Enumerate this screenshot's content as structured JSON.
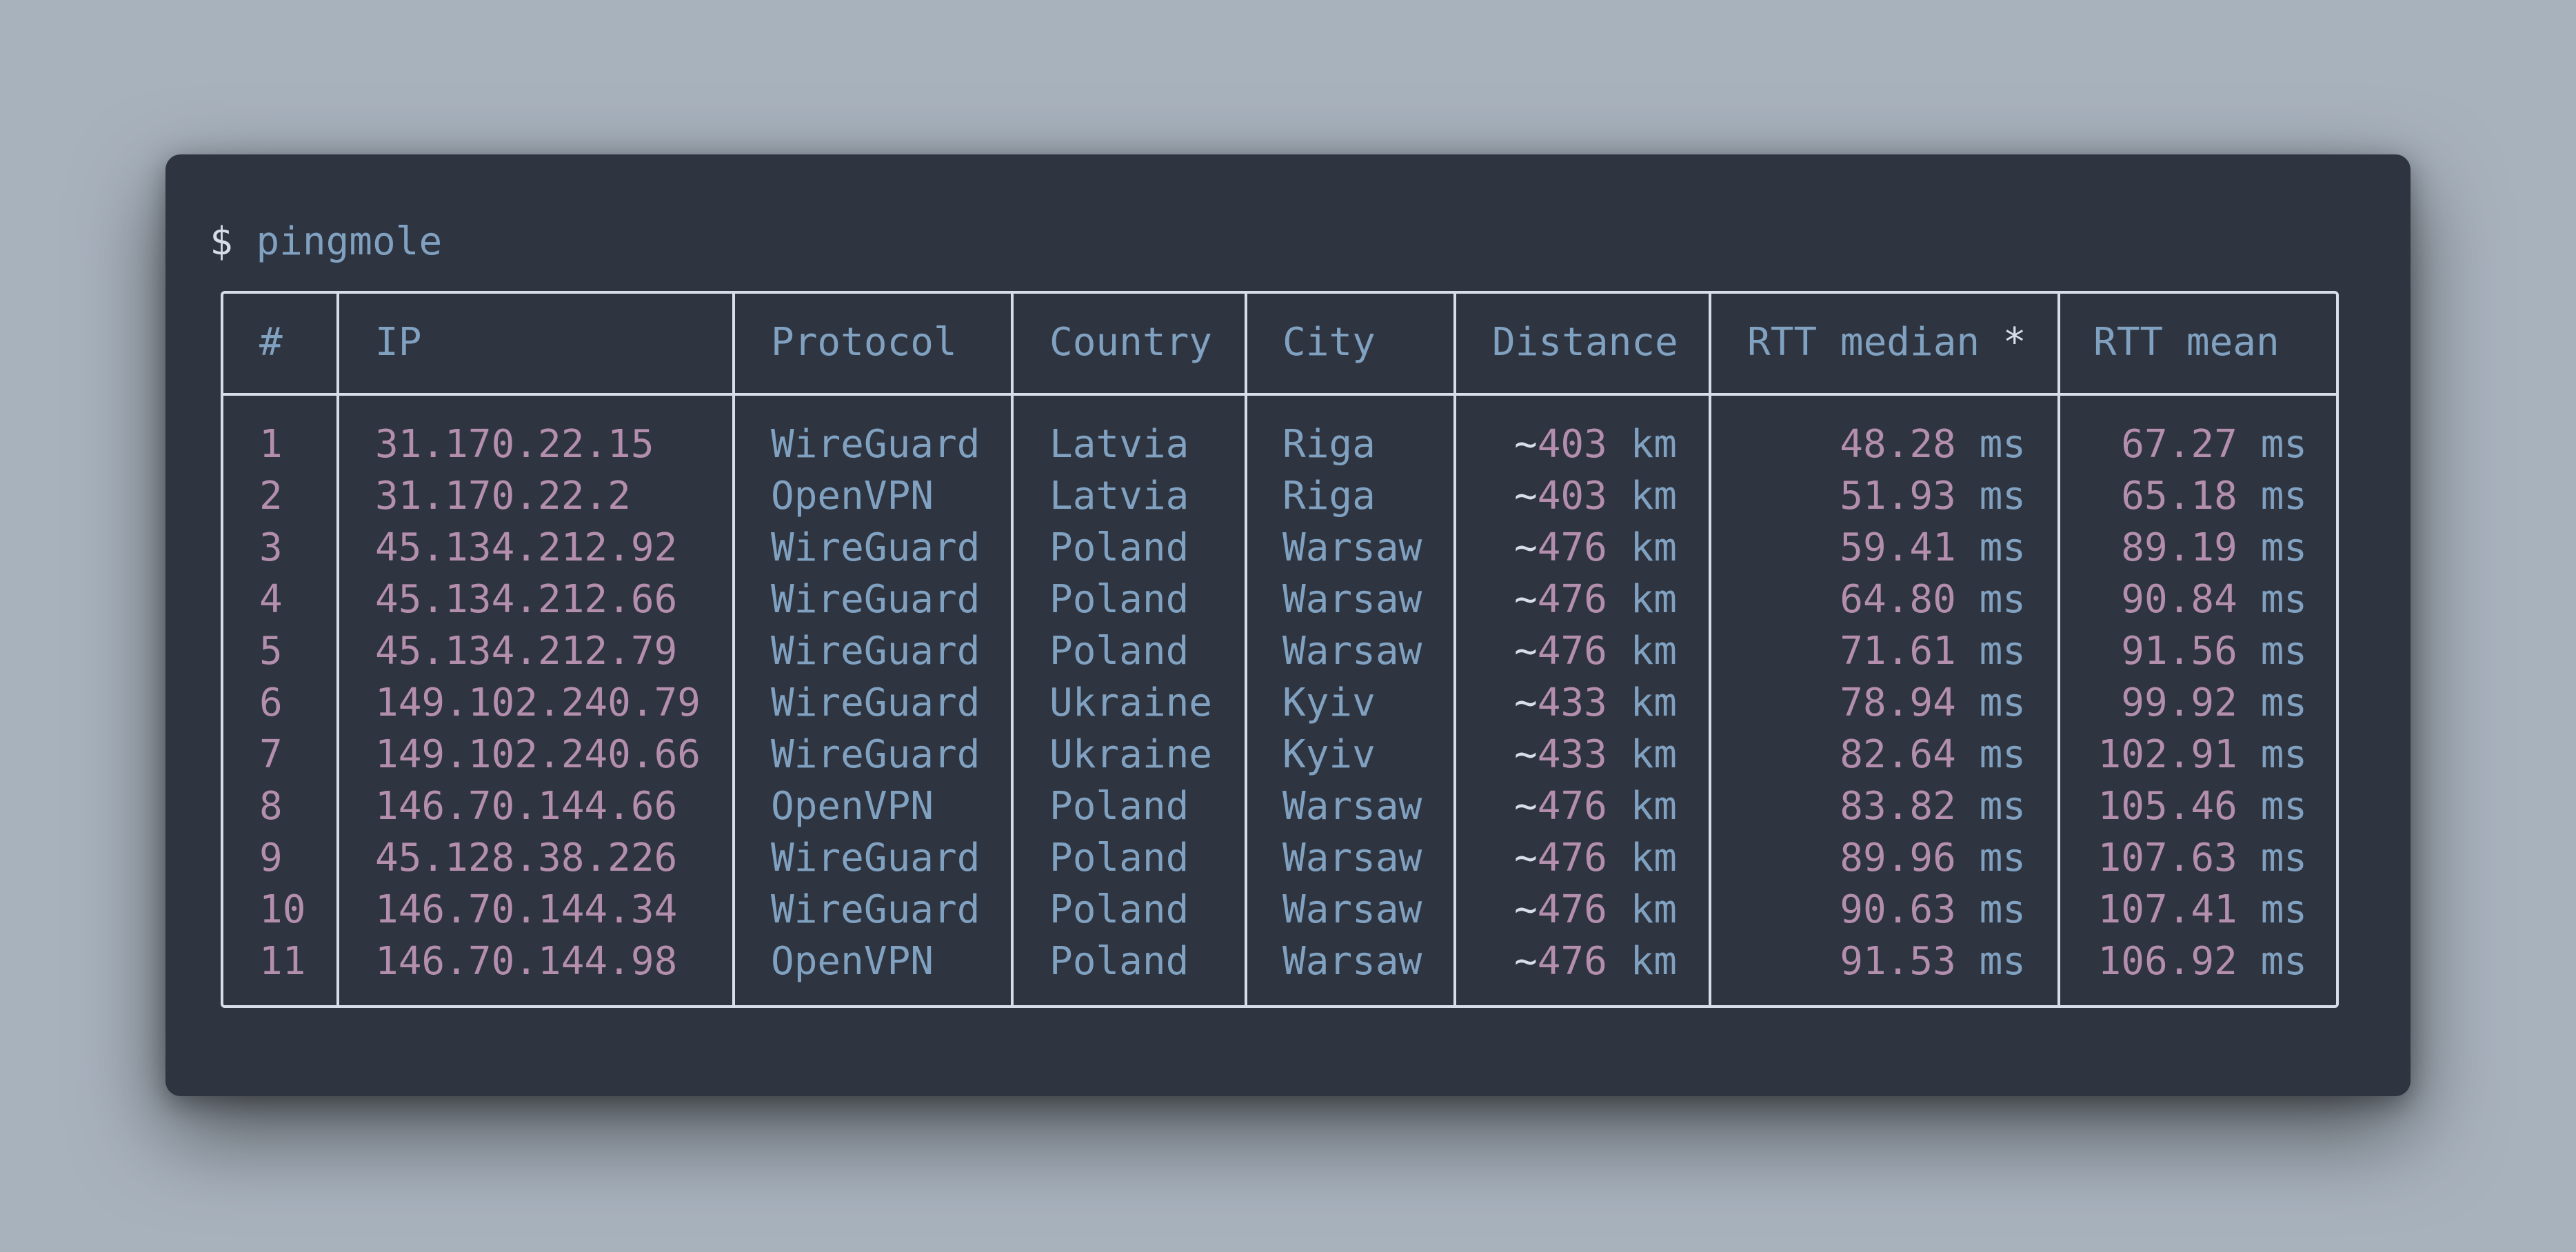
{
  "terminal": {
    "prompt_symbol": "$",
    "command": "pingmole"
  },
  "table": {
    "headers": {
      "num": "#",
      "ip": "IP",
      "protocol": "Protocol",
      "country": "Country",
      "city": "City",
      "distance": "Distance",
      "rtt_median": "RTT median",
      "rtt_median_marker": "*",
      "rtt_mean": "RTT mean"
    },
    "rows": [
      {
        "num": "1",
        "ip": "31.170.22.15",
        "protocol": "WireGuard",
        "country": "Latvia",
        "city": "Riga",
        "distance": "403",
        "rtt_median": "48.28",
        "rtt_mean": "67.27"
      },
      {
        "num": "2",
        "ip": "31.170.22.2",
        "protocol": "OpenVPN",
        "country": "Latvia",
        "city": "Riga",
        "distance": "403",
        "rtt_median": "51.93",
        "rtt_mean": "65.18"
      },
      {
        "num": "3",
        "ip": "45.134.212.92",
        "protocol": "WireGuard",
        "country": "Poland",
        "city": "Warsaw",
        "distance": "476",
        "rtt_median": "59.41",
        "rtt_mean": "89.19"
      },
      {
        "num": "4",
        "ip": "45.134.212.66",
        "protocol": "WireGuard",
        "country": "Poland",
        "city": "Warsaw",
        "distance": "476",
        "rtt_median": "64.80",
        "rtt_mean": "90.84"
      },
      {
        "num": "5",
        "ip": "45.134.212.79",
        "protocol": "WireGuard",
        "country": "Poland",
        "city": "Warsaw",
        "distance": "476",
        "rtt_median": "71.61",
        "rtt_mean": "91.56"
      },
      {
        "num": "6",
        "ip": "149.102.240.79",
        "protocol": "WireGuard",
        "country": "Ukraine",
        "city": "Kyiv",
        "distance": "433",
        "rtt_median": "78.94",
        "rtt_mean": "99.92"
      },
      {
        "num": "7",
        "ip": "149.102.240.66",
        "protocol": "WireGuard",
        "country": "Ukraine",
        "city": "Kyiv",
        "distance": "433",
        "rtt_median": "82.64",
        "rtt_mean": "102.91"
      },
      {
        "num": "8",
        "ip": "146.70.144.66",
        "protocol": "OpenVPN",
        "country": "Poland",
        "city": "Warsaw",
        "distance": "476",
        "rtt_median": "83.82",
        "rtt_mean": "105.46"
      },
      {
        "num": "9",
        "ip": "45.128.38.226",
        "protocol": "WireGuard",
        "country": "Poland",
        "city": "Warsaw",
        "distance": "476",
        "rtt_median": "89.96",
        "rtt_mean": "107.63"
      },
      {
        "num": "10",
        "ip": "146.70.144.34",
        "protocol": "WireGuard",
        "country": "Poland",
        "city": "Warsaw",
        "distance": "476",
        "rtt_median": "90.63",
        "rtt_mean": "107.41"
      },
      {
        "num": "11",
        "ip": "146.70.144.98",
        "protocol": "OpenVPN",
        "country": "Poland",
        "city": "Warsaw",
        "distance": "476",
        "rtt_median": "91.53",
        "rtt_mean": "106.92"
      }
    ],
    "distance_prefix": "~",
    "distance_unit": "km",
    "rtt_unit": "ms"
  },
  "colors": {
    "window_bg": "#2e3440",
    "page_bg": "#a8b2bd",
    "border": "#d8dee9",
    "accent_blue": "#81a1c1",
    "accent_pink": "#b48ead"
  }
}
